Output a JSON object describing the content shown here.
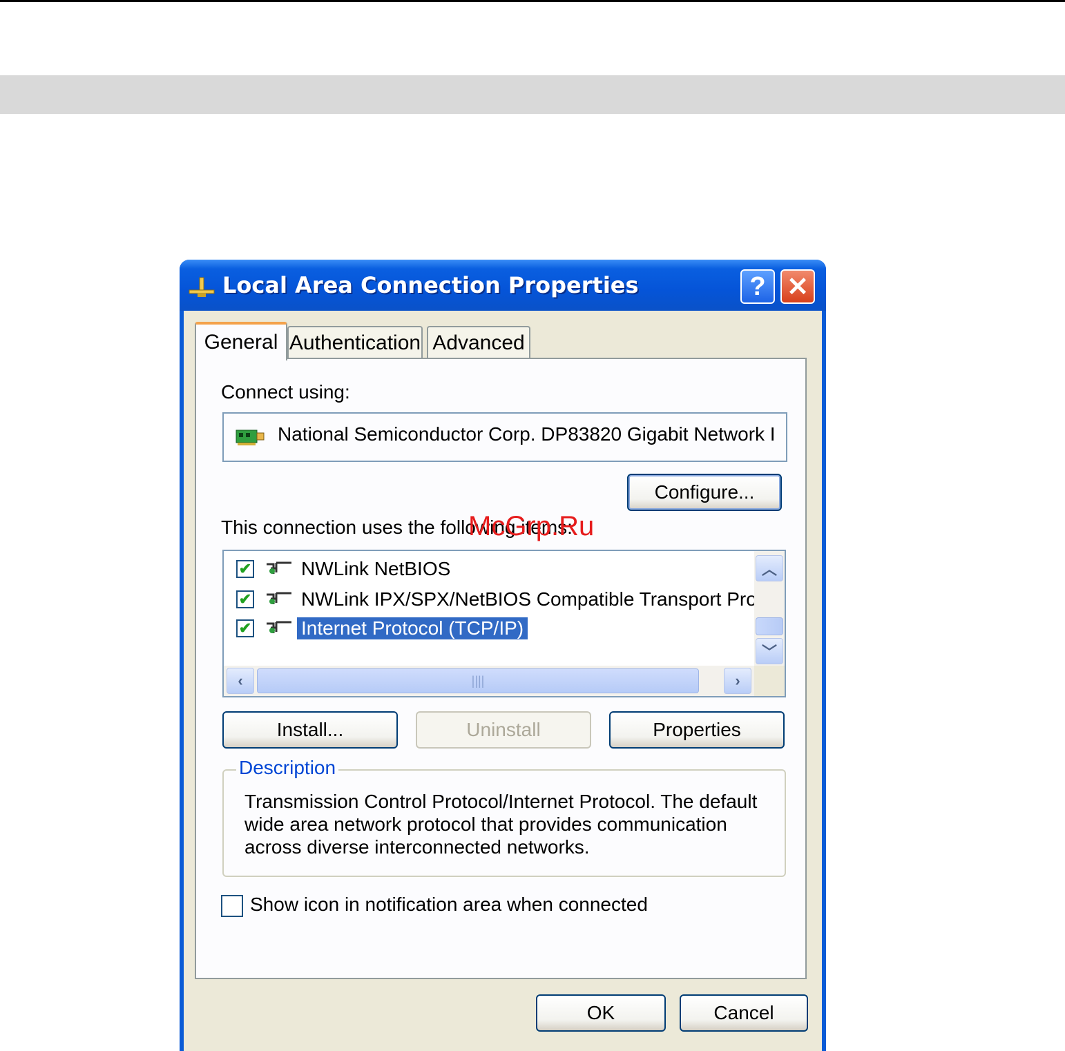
{
  "window": {
    "title": "Local Area Connection Properties",
    "help_glyph": "?",
    "close_glyph": "✕"
  },
  "tabs": [
    {
      "label": "General",
      "selected": true
    },
    {
      "label": "Authentication",
      "selected": false
    },
    {
      "label": "Advanced",
      "selected": false
    }
  ],
  "general": {
    "connect_using_label": "Connect using:",
    "adapter_name": "National Semiconductor Corp. DP83820 Gigabit Network I",
    "configure_label": "Configure...",
    "items_label": "This connection uses the following items:",
    "items": [
      {
        "label": "NWLink NetBIOS",
        "checked": true,
        "selected": false
      },
      {
        "label": "NWLink IPX/SPX/NetBIOS Compatible Transport Prot",
        "checked": true,
        "selected": false
      },
      {
        "label": "Internet Protocol (TCP/IP)",
        "checked": true,
        "selected": true
      }
    ],
    "install_label": "Install...",
    "uninstall_label": "Uninstall",
    "properties_label": "Properties",
    "description_legend": "Description",
    "description_text": "Transmission Control Protocol/Internet Protocol. The default wide area network protocol that provides communication across diverse interconnected networks.",
    "show_icon_label": "Show icon in notification area when connected",
    "show_icon_checked": false
  },
  "footer": {
    "ok_label": "OK",
    "cancel_label": "Cancel"
  },
  "watermark": "McGrp.Ru",
  "colors": {
    "titlebar": "#0554d8",
    "dialog_bg": "#ece9d8",
    "selection": "#316ac5",
    "legend": "#0046d5"
  }
}
